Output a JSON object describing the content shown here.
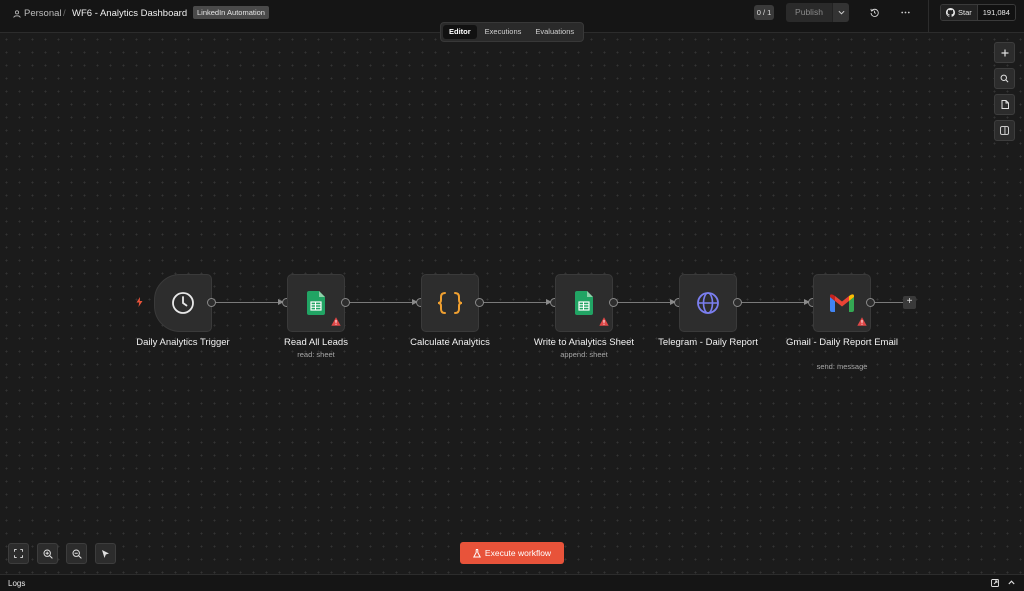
{
  "header": {
    "project": "Personal",
    "separator": "/",
    "workflow_title": "WF6 - Analytics Dashboard",
    "tag": "LinkedIn Automation",
    "counter": "0 / 1",
    "publish_label": "Publish",
    "github": {
      "star_label": "Star",
      "star_count": "191,084"
    }
  },
  "tabs": [
    {
      "label": "Editor",
      "active": true
    },
    {
      "label": "Executions",
      "active": false
    },
    {
      "label": "Evaluations",
      "active": false
    }
  ],
  "sidebar_icons": [
    "plus-icon",
    "search-icon",
    "sticky-note-icon",
    "panel-toggle-icon"
  ],
  "nodes": [
    {
      "label": "Daily Analytics Trigger",
      "subtitle": "",
      "icon": "clock-icon",
      "warning": false
    },
    {
      "label": "Read All Leads",
      "subtitle": "read: sheet",
      "icon": "google-sheets-icon",
      "warning": true
    },
    {
      "label": "Calculate Analytics",
      "subtitle": "",
      "icon": "code-braces-icon",
      "warning": false
    },
    {
      "label": "Write to Analytics Sheet",
      "subtitle": "append: sheet",
      "icon": "google-sheets-icon",
      "warning": true
    },
    {
      "label": "Telegram - Daily Report",
      "subtitle": "",
      "icon": "globe-icon",
      "warning": false
    },
    {
      "label": "Gmail - Daily Report Email",
      "subtitle": "send: message",
      "icon": "gmail-icon",
      "warning": true
    }
  ],
  "bottom_controls": [
    "fit-view-icon",
    "zoom-in-icon",
    "zoom-out-icon",
    "pointer-icon"
  ],
  "execute_label": "Execute workflow",
  "logs_label": "Logs",
  "colors": {
    "accent": "#e8533a",
    "sheets": "#21a464",
    "code": "#f0a030",
    "globe": "#7b7ff0",
    "warning": "#e04848"
  }
}
